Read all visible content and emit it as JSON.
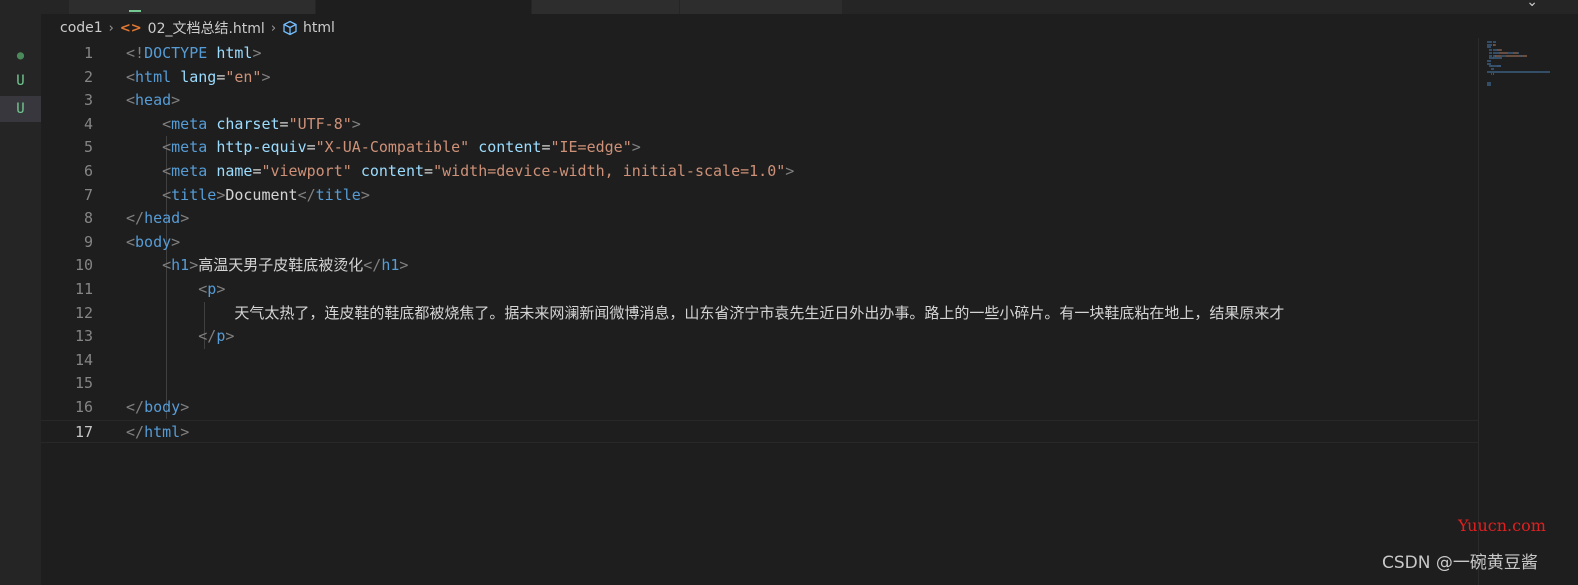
{
  "colors": {
    "background": "#1e1e1e",
    "punctuation": "#808080",
    "tag": "#569cd6",
    "attribute": "#9cdcfe",
    "string": "#ce9178",
    "text": "#d4d4d4",
    "line_number": "#858585",
    "scm_untracked": "#73c991",
    "html_icon": "#e37933",
    "watermark_red": "#e02020"
  },
  "breadcrumb": {
    "folder": "code1",
    "file_icon": "html-file-icon",
    "file": "02_文档总结.html",
    "symbol_icon": "cube-icon",
    "symbol": "html"
  },
  "scm_gutter": {
    "marks": [
      {
        "glyph": "●",
        "kind": "dot"
      },
      {
        "glyph": "U",
        "kind": "untracked"
      },
      {
        "glyph": "U",
        "kind": "untracked-active"
      }
    ]
  },
  "editor": {
    "current_line": 17,
    "lines": [
      {
        "n": "1",
        "tokens": [
          [
            "p",
            "<!"
          ],
          [
            "d",
            "DOCTYPE"
          ],
          [
            "x",
            " "
          ],
          [
            "a",
            "html"
          ],
          [
            "p",
            ">"
          ]
        ]
      },
      {
        "n": "2",
        "tokens": [
          [
            "p",
            "<"
          ],
          [
            "t",
            "html"
          ],
          [
            "x",
            " "
          ],
          [
            "a",
            "lang"
          ],
          [
            "x",
            "="
          ],
          [
            "s",
            "\"en\""
          ],
          [
            "p",
            ">"
          ]
        ]
      },
      {
        "n": "3",
        "tokens": [
          [
            "p",
            "<"
          ],
          [
            "t",
            "head"
          ],
          [
            "p",
            ">"
          ]
        ]
      },
      {
        "n": "4",
        "tokens": [
          [
            "x",
            "    "
          ],
          [
            "p",
            "<"
          ],
          [
            "t",
            "meta"
          ],
          [
            "x",
            " "
          ],
          [
            "a",
            "charset"
          ],
          [
            "x",
            "="
          ],
          [
            "s",
            "\"UTF-8\""
          ],
          [
            "p",
            ">"
          ]
        ]
      },
      {
        "n": "5",
        "tokens": [
          [
            "x",
            "    "
          ],
          [
            "p",
            "<"
          ],
          [
            "t",
            "meta"
          ],
          [
            "x",
            " "
          ],
          [
            "a",
            "http-equiv"
          ],
          [
            "x",
            "="
          ],
          [
            "s",
            "\"X-UA-Compatible\""
          ],
          [
            "x",
            " "
          ],
          [
            "a",
            "content"
          ],
          [
            "x",
            "="
          ],
          [
            "s",
            "\"IE=edge\""
          ],
          [
            "p",
            ">"
          ]
        ]
      },
      {
        "n": "6",
        "tokens": [
          [
            "x",
            "    "
          ],
          [
            "p",
            "<"
          ],
          [
            "t",
            "meta"
          ],
          [
            "x",
            " "
          ],
          [
            "a",
            "name"
          ],
          [
            "x",
            "="
          ],
          [
            "s",
            "\"viewport\""
          ],
          [
            "x",
            " "
          ],
          [
            "a",
            "content"
          ],
          [
            "x",
            "="
          ],
          [
            "s",
            "\"width=device-width, initial-scale=1.0\""
          ],
          [
            "p",
            ">"
          ]
        ]
      },
      {
        "n": "7",
        "tokens": [
          [
            "x",
            "    "
          ],
          [
            "p",
            "<"
          ],
          [
            "t",
            "title"
          ],
          [
            "p",
            ">"
          ],
          [
            "x",
            "Document"
          ],
          [
            "p",
            "</"
          ],
          [
            "t",
            "title"
          ],
          [
            "p",
            ">"
          ]
        ]
      },
      {
        "n": "8",
        "tokens": [
          [
            "p",
            "</"
          ],
          [
            "t",
            "head"
          ],
          [
            "p",
            ">"
          ]
        ]
      },
      {
        "n": "9",
        "tokens": [
          [
            "p",
            "<"
          ],
          [
            "t",
            "body"
          ],
          [
            "p",
            ">"
          ]
        ]
      },
      {
        "n": "10",
        "tokens": [
          [
            "x",
            "    "
          ],
          [
            "p",
            "<"
          ],
          [
            "t",
            "h1"
          ],
          [
            "p",
            ">"
          ],
          [
            "x",
            "高温天男子皮鞋底被烫化"
          ],
          [
            "p",
            "</"
          ],
          [
            "t",
            "h1"
          ],
          [
            "p",
            ">"
          ]
        ]
      },
      {
        "n": "11",
        "tokens": [
          [
            "x",
            "        "
          ],
          [
            "p",
            "<"
          ],
          [
            "t",
            "p"
          ],
          [
            "p",
            ">"
          ]
        ]
      },
      {
        "n": "12",
        "tokens": [
          [
            "x",
            "            天气太热了，连皮鞋的鞋底都被烧焦了。据未来网澜新闻微博消息，山东省济宁市袁先生近日外出办事。路上的一些小碎片。有一块鞋底粘在地上，结果原来才"
          ]
        ]
      },
      {
        "n": "13",
        "tokens": [
          [
            "x",
            "        "
          ],
          [
            "p",
            "</"
          ],
          [
            "t",
            "p"
          ],
          [
            "p",
            ">"
          ]
        ]
      },
      {
        "n": "14",
        "tokens": []
      },
      {
        "n": "15",
        "tokens": []
      },
      {
        "n": "16",
        "tokens": [
          [
            "p",
            "</"
          ],
          [
            "t",
            "body"
          ],
          [
            "p",
            ">"
          ]
        ]
      },
      {
        "n": "17",
        "tokens": [
          [
            "p",
            "</"
          ],
          [
            "t",
            "html"
          ],
          [
            "p",
            ">"
          ]
        ]
      }
    ]
  },
  "watermarks": {
    "site": "Yuucn.com",
    "author": "CSDN @一碗黄豆酱"
  },
  "topright_glyph": "⌄"
}
